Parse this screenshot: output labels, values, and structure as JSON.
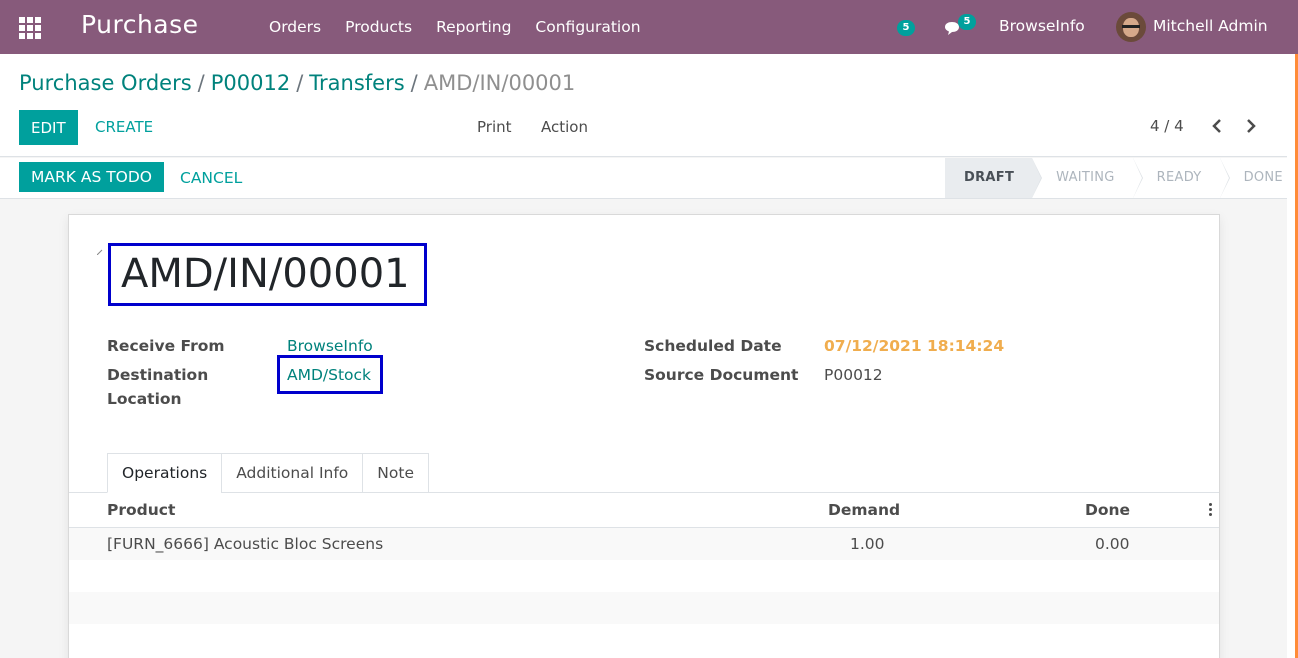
{
  "app": {
    "title": "Purchase",
    "menu": [
      "Orders",
      "Products",
      "Reporting",
      "Configuration"
    ],
    "activity_count": "5",
    "messages_count": "5",
    "company": "BrowseInfo",
    "user": "Mitchell Admin"
  },
  "breadcrumb": {
    "items": [
      "Purchase Orders",
      "P00012",
      "Transfers"
    ],
    "current": "AMD/IN/00001",
    "separator": "/"
  },
  "toolbar": {
    "edit_label": "EDIT",
    "create_label": "CREATE",
    "print_label": "Print",
    "action_label": "Action",
    "pager": "4 / 4"
  },
  "statusbar": {
    "todo_label": "MARK AS TODO",
    "cancel_label": "CANCEL",
    "stages": [
      "DRAFT",
      "WAITING",
      "READY",
      "DONE"
    ],
    "active_stage": "DRAFT"
  },
  "form": {
    "reference": "AMD/IN/00001",
    "receive_from_label": "Receive From",
    "receive_from": "BrowseInfo",
    "destination_label_1": "Destination",
    "destination_label_2": "Location",
    "destination": "AMD/Stock",
    "scheduled_date_label": "Scheduled Date",
    "scheduled_date": "07/12/2021 18:14:24",
    "source_document_label": "Source Document",
    "source_document": "P00012"
  },
  "tabs": [
    "Operations",
    "Additional Info",
    "Note"
  ],
  "table": {
    "headers": {
      "product": "Product",
      "demand": "Demand",
      "done": "Done"
    },
    "rows": [
      {
        "product": "[FURN_6666] Acoustic Bloc Screens",
        "demand": "1.00",
        "done": "0.00"
      }
    ]
  },
  "colors": {
    "navbar": "#875a7b",
    "primary": "#00a09d",
    "link": "#00827c",
    "date_warning": "#f0ad4e",
    "highlight_box": "#0000cc"
  }
}
